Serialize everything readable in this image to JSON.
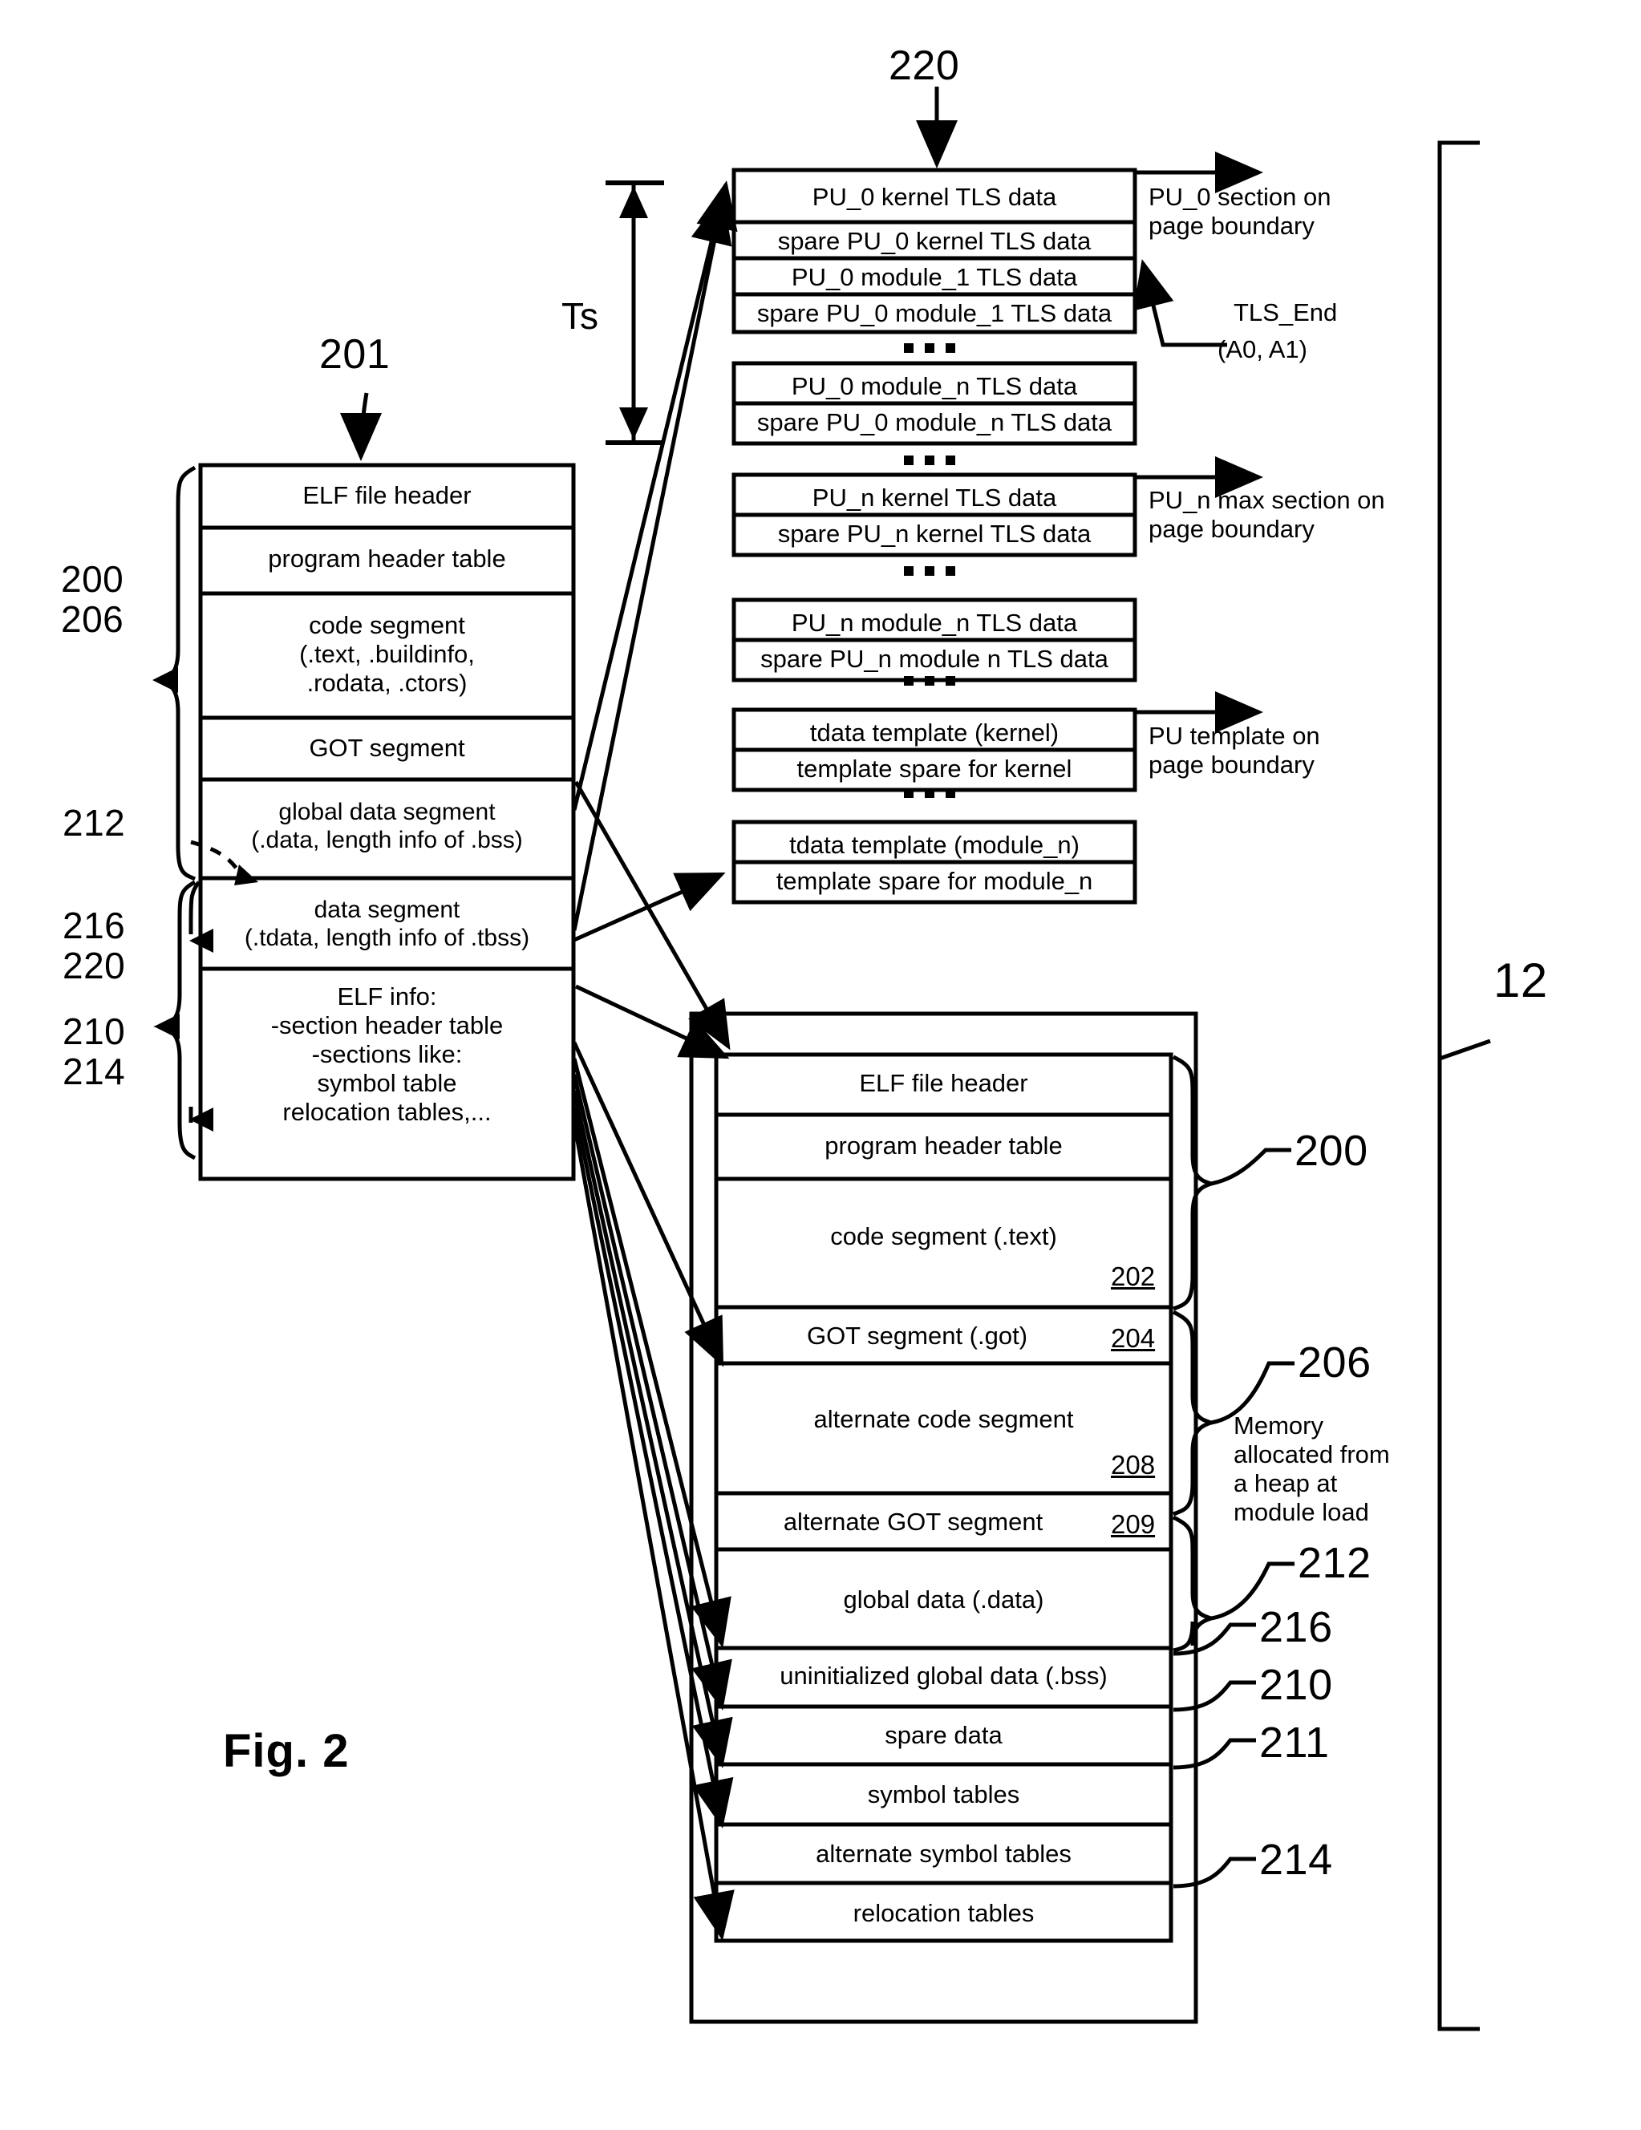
{
  "figure": {
    "title": "Fig. 2",
    "top_ref": "220",
    "elf_file_ref": "201",
    "ts_label": "Ts",
    "outer_system_ref": "12"
  },
  "tls_area": {
    "blocks": [
      {
        "rows": [
          "PU_0 kernel TLS data",
          "spare PU_0 kernel TLS data",
          "PU_0 module_1 TLS data",
          "spare PU_0 module_1 TLS data"
        ]
      },
      {
        "rows": [
          "PU_0 module_n TLS data",
          "spare PU_0 module_n TLS data"
        ]
      },
      {
        "rows": [
          "PU_n kernel TLS data",
          "spare PU_n kernel TLS data"
        ]
      },
      {
        "rows": [
          "PU_n module_n TLS data",
          "spare PU_n module n TLS data"
        ]
      },
      {
        "rows": [
          "tdata template (kernel)",
          "template spare for kernel"
        ]
      },
      {
        "rows": [
          "tdata template (module_n)",
          "template spare for module_n"
        ]
      }
    ],
    "annotations": {
      "pu0_section": "PU_0 section on\npage boundary",
      "pun_section": "PU_n max section on\npage boundary",
      "pu_template": "PU template on\npage boundary",
      "tls_end": "TLS_End",
      "tls_end_regs": "(A0, A1)"
    }
  },
  "elf_file": {
    "rows": [
      "ELF file header",
      "program header table",
      "code segment\n(.text, .buildinfo,\n.rodata, .ctors)",
      "GOT segment",
      "global data segment\n(.data, length info of .bss)",
      "data segment\n(.tdata, length info of .tbss)",
      "ELF info:\n-section header table\n-sections like:\nsymbol table\nrelocation tables,..."
    ],
    "left_refs": {
      "group_200_206": "200\n206",
      "ref_212": "212",
      "group_216_220": "216\n220",
      "group_210_214": "210\n214"
    }
  },
  "memory_image": {
    "rows": [
      {
        "label": "ELF file header",
        "ref": ""
      },
      {
        "label": "program header table",
        "ref": ""
      },
      {
        "label": "code segment (.text)",
        "ref": "202"
      },
      {
        "label": "GOT segment (.got)",
        "ref": "204"
      },
      {
        "label": "alternate code segment",
        "ref": "208"
      },
      {
        "label": "alternate GOT segment",
        "ref": "209"
      },
      {
        "label": "global data (.data)",
        "ref": ""
      },
      {
        "label": "uninitialized global data (.bss)",
        "ref": ""
      },
      {
        "label": "spare data",
        "ref": ""
      },
      {
        "label": "symbol tables",
        "ref": ""
      },
      {
        "label": "alternate symbol tables",
        "ref": ""
      },
      {
        "label": "relocation tables",
        "ref": ""
      }
    ],
    "right_refs": [
      {
        "num": "200",
        "note": ""
      },
      {
        "num": "206",
        "note": "Memory\nallocated from\na heap at\nmodule load"
      },
      {
        "num": "212",
        "note": ""
      },
      {
        "num": "216",
        "note": ""
      },
      {
        "num": "210",
        "note": ""
      },
      {
        "num": "211",
        "note": ""
      },
      {
        "num": "214",
        "note": ""
      }
    ]
  }
}
